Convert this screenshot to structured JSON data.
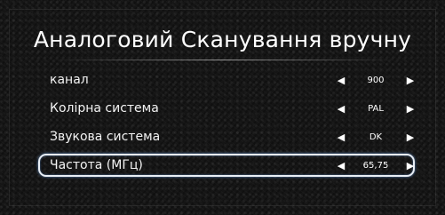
{
  "title": "Аналоговий Сканування вручну",
  "rows": [
    {
      "label": "канал",
      "value": "900",
      "left_icon": "triangle-left",
      "right_icon": "triangle-right"
    },
    {
      "label": "Колірна система",
      "value": "PAL",
      "left_icon": "triangle-left",
      "right_icon": "triangle-right"
    },
    {
      "label": "Звукова система",
      "value": "DK",
      "left_icon": "triangle-left",
      "right_icon": "triangle-right"
    },
    {
      "label": "Частота (МГц)",
      "value": "65,75",
      "left_icon": "triangle-left",
      "right_icon": "triangle-right",
      "selected": true
    }
  ],
  "colors": {
    "highlight_border": "#e8eef5",
    "text": "#f2f2f2",
    "background": "#151515"
  }
}
